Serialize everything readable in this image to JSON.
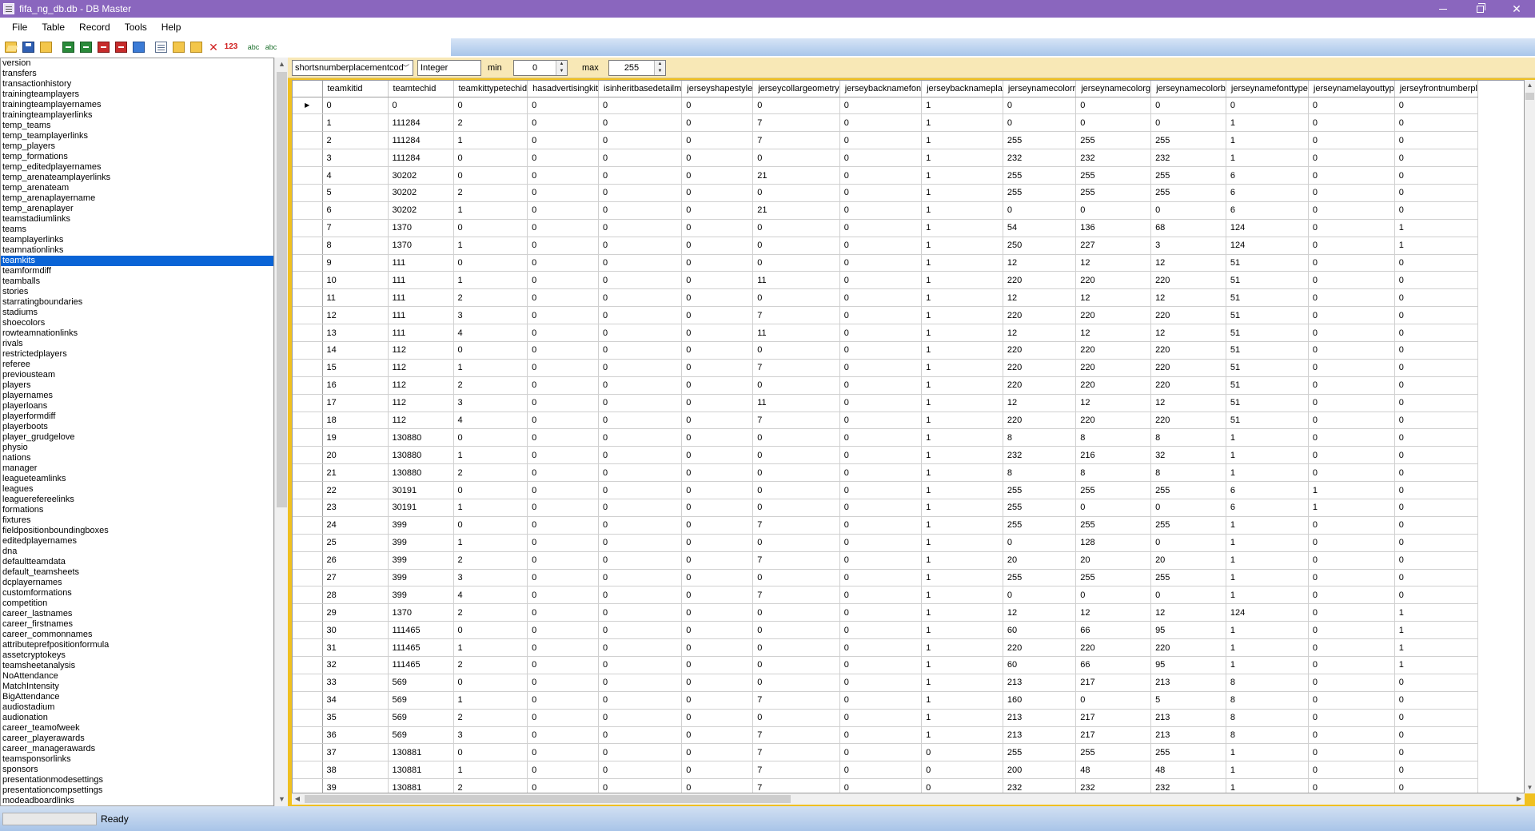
{
  "window": {
    "title": "fifa_ng_db.db - DB Master"
  },
  "menu": [
    "File",
    "Table",
    "Record",
    "Tools",
    "Help"
  ],
  "toolbar_icons": [
    "open-folder-icon",
    "save-icon",
    "folder-icon",
    "import-icon",
    "export-icon",
    "delete-table-icon",
    "delete-record-icon",
    "compare-icon",
    "copy-icon",
    "paste-icon",
    "paste-special-icon",
    "delete-icon",
    "numbers-icon",
    "spellcheck-icon",
    "find-replace-icon"
  ],
  "tables": [
    "version",
    "transfers",
    "transactionhistory",
    "trainingteamplayers",
    "trainingteamplayernames",
    "trainingteamplayerlinks",
    "temp_teams",
    "temp_teamplayerlinks",
    "temp_players",
    "temp_formations",
    "temp_editedplayernames",
    "temp_arenateamplayerlinks",
    "temp_arenateam",
    "temp_arenaplayername",
    "temp_arenaplayer",
    "teamstadiumlinks",
    "teams",
    "teamplayerlinks",
    "teamnationlinks",
    "teamkits",
    "teamformdiff",
    "teamballs",
    "stories",
    "starratingboundaries",
    "stadiums",
    "shoecolors",
    "rowteamnationlinks",
    "rivals",
    "restrictedplayers",
    "referee",
    "previousteam",
    "players",
    "playernames",
    "playerloans",
    "playerformdiff",
    "playerboots",
    "player_grudgelove",
    "physio",
    "nations",
    "manager",
    "leagueteamlinks",
    "leagues",
    "leaguerefereelinks",
    "formations",
    "fixtures",
    "fieldpositionboundingboxes",
    "editedplayernames",
    "dna",
    "defaultteamdata",
    "default_teamsheets",
    "dcplayernames",
    "customformations",
    "competition",
    "career_lastnames",
    "career_firstnames",
    "career_commonnames",
    "attributeprefpositionformula",
    "assetcryptokeys",
    "teamsheetanalysis",
    "NoAttendance",
    "MatchIntensity",
    "BigAttendance",
    "audiostadium",
    "audionation",
    "career_teamofweek",
    "career_playerawards",
    "career_managerawards",
    "teamsponsorlinks",
    "sponsors",
    "presentationmodesettings",
    "presentationcompsettings",
    "modeadboardlinks"
  ],
  "selected_table": "teamkits",
  "field_bar": {
    "field": "shortsnumberplacementcod",
    "type": "Integer",
    "min_label": "min",
    "min_value": "0",
    "max_label": "max",
    "max_value": "255"
  },
  "columns": [
    "teamkitid",
    "teamtechid",
    "teamkittypetechid",
    "hasadvertisingkit",
    "isinheritbasedetailm",
    "jerseyshapestyle",
    "jerseycollargeometry",
    "jerseybacknamefon",
    "jerseybacknamepla",
    "jerseynamecolorr",
    "jerseynamecolorg",
    "jerseynamecolorb",
    "jerseynamefonttype",
    "jerseynamelayouttyp",
    "jerseyfrontnumberpl"
  ],
  "rows": [
    [
      "0",
      "0",
      "0",
      "0",
      "0",
      "0",
      "0",
      "0",
      "1",
      "0",
      "0",
      "0",
      "0",
      "0",
      "0"
    ],
    [
      "1",
      "111284",
      "2",
      "0",
      "0",
      "0",
      "7",
      "0",
      "1",
      "0",
      "0",
      "0",
      "1",
      "0",
      "0"
    ],
    [
      "2",
      "111284",
      "1",
      "0",
      "0",
      "0",
      "7",
      "0",
      "1",
      "255",
      "255",
      "255",
      "1",
      "0",
      "0"
    ],
    [
      "3",
      "111284",
      "0",
      "0",
      "0",
      "0",
      "0",
      "0",
      "1",
      "232",
      "232",
      "232",
      "1",
      "0",
      "0"
    ],
    [
      "4",
      "30202",
      "0",
      "0",
      "0",
      "0",
      "21",
      "0",
      "1",
      "255",
      "255",
      "255",
      "6",
      "0",
      "0"
    ],
    [
      "5",
      "30202",
      "2",
      "0",
      "0",
      "0",
      "0",
      "0",
      "1",
      "255",
      "255",
      "255",
      "6",
      "0",
      "0"
    ],
    [
      "6",
      "30202",
      "1",
      "0",
      "0",
      "0",
      "21",
      "0",
      "1",
      "0",
      "0",
      "0",
      "6",
      "0",
      "0"
    ],
    [
      "7",
      "1370",
      "0",
      "0",
      "0",
      "0",
      "0",
      "0",
      "1",
      "54",
      "136",
      "68",
      "124",
      "0",
      "1"
    ],
    [
      "8",
      "1370",
      "1",
      "0",
      "0",
      "0",
      "0",
      "0",
      "1",
      "250",
      "227",
      "3",
      "124",
      "0",
      "1"
    ],
    [
      "9",
      "111",
      "0",
      "0",
      "0",
      "0",
      "0",
      "0",
      "1",
      "12",
      "12",
      "12",
      "51",
      "0",
      "0"
    ],
    [
      "10",
      "111",
      "1",
      "0",
      "0",
      "0",
      "11",
      "0",
      "1",
      "220",
      "220",
      "220",
      "51",
      "0",
      "0"
    ],
    [
      "11",
      "111",
      "2",
      "0",
      "0",
      "0",
      "0",
      "0",
      "1",
      "12",
      "12",
      "12",
      "51",
      "0",
      "0"
    ],
    [
      "12",
      "111",
      "3",
      "0",
      "0",
      "0",
      "7",
      "0",
      "1",
      "220",
      "220",
      "220",
      "51",
      "0",
      "0"
    ],
    [
      "13",
      "111",
      "4",
      "0",
      "0",
      "0",
      "11",
      "0",
      "1",
      "12",
      "12",
      "12",
      "51",
      "0",
      "0"
    ],
    [
      "14",
      "112",
      "0",
      "0",
      "0",
      "0",
      "0",
      "0",
      "1",
      "220",
      "220",
      "220",
      "51",
      "0",
      "0"
    ],
    [
      "15",
      "112",
      "1",
      "0",
      "0",
      "0",
      "7",
      "0",
      "1",
      "220",
      "220",
      "220",
      "51",
      "0",
      "0"
    ],
    [
      "16",
      "112",
      "2",
      "0",
      "0",
      "0",
      "0",
      "0",
      "1",
      "220",
      "220",
      "220",
      "51",
      "0",
      "0"
    ],
    [
      "17",
      "112",
      "3",
      "0",
      "0",
      "0",
      "11",
      "0",
      "1",
      "12",
      "12",
      "12",
      "51",
      "0",
      "0"
    ],
    [
      "18",
      "112",
      "4",
      "0",
      "0",
      "0",
      "7",
      "0",
      "1",
      "220",
      "220",
      "220",
      "51",
      "0",
      "0"
    ],
    [
      "19",
      "130880",
      "0",
      "0",
      "0",
      "0",
      "0",
      "0",
      "1",
      "8",
      "8",
      "8",
      "1",
      "0",
      "0"
    ],
    [
      "20",
      "130880",
      "1",
      "0",
      "0",
      "0",
      "0",
      "0",
      "1",
      "232",
      "216",
      "32",
      "1",
      "0",
      "0"
    ],
    [
      "21",
      "130880",
      "2",
      "0",
      "0",
      "0",
      "0",
      "0",
      "1",
      "8",
      "8",
      "8",
      "1",
      "0",
      "0"
    ],
    [
      "22",
      "30191",
      "0",
      "0",
      "0",
      "0",
      "0",
      "0",
      "1",
      "255",
      "255",
      "255",
      "6",
      "1",
      "0"
    ],
    [
      "23",
      "30191",
      "1",
      "0",
      "0",
      "0",
      "0",
      "0",
      "1",
      "255",
      "0",
      "0",
      "6",
      "1",
      "0"
    ],
    [
      "24",
      "399",
      "0",
      "0",
      "0",
      "0",
      "7",
      "0",
      "1",
      "255",
      "255",
      "255",
      "1",
      "0",
      "0"
    ],
    [
      "25",
      "399",
      "1",
      "0",
      "0",
      "0",
      "0",
      "0",
      "1",
      "0",
      "128",
      "0",
      "1",
      "0",
      "0"
    ],
    [
      "26",
      "399",
      "2",
      "0",
      "0",
      "0",
      "7",
      "0",
      "1",
      "20",
      "20",
      "20",
      "1",
      "0",
      "0"
    ],
    [
      "27",
      "399",
      "3",
      "0",
      "0",
      "0",
      "0",
      "0",
      "1",
      "255",
      "255",
      "255",
      "1",
      "0",
      "0"
    ],
    [
      "28",
      "399",
      "4",
      "0",
      "0",
      "0",
      "7",
      "0",
      "1",
      "0",
      "0",
      "0",
      "1",
      "0",
      "0"
    ],
    [
      "29",
      "1370",
      "2",
      "0",
      "0",
      "0",
      "0",
      "0",
      "1",
      "12",
      "12",
      "12",
      "124",
      "0",
      "1"
    ],
    [
      "30",
      "111465",
      "0",
      "0",
      "0",
      "0",
      "0",
      "0",
      "1",
      "60",
      "66",
      "95",
      "1",
      "0",
      "1"
    ],
    [
      "31",
      "111465",
      "1",
      "0",
      "0",
      "0",
      "0",
      "0",
      "1",
      "220",
      "220",
      "220",
      "1",
      "0",
      "1"
    ],
    [
      "32",
      "111465",
      "2",
      "0",
      "0",
      "0",
      "0",
      "0",
      "1",
      "60",
      "66",
      "95",
      "1",
      "0",
      "1"
    ],
    [
      "33",
      "569",
      "0",
      "0",
      "0",
      "0",
      "0",
      "0",
      "1",
      "213",
      "217",
      "213",
      "8",
      "0",
      "0"
    ],
    [
      "34",
      "569",
      "1",
      "0",
      "0",
      "0",
      "7",
      "0",
      "1",
      "160",
      "0",
      "5",
      "8",
      "0",
      "0"
    ],
    [
      "35",
      "569",
      "2",
      "0",
      "0",
      "0",
      "0",
      "0",
      "1",
      "213",
      "217",
      "213",
      "8",
      "0",
      "0"
    ],
    [
      "36",
      "569",
      "3",
      "0",
      "0",
      "0",
      "7",
      "0",
      "1",
      "213",
      "217",
      "213",
      "8",
      "0",
      "0"
    ],
    [
      "37",
      "130881",
      "0",
      "0",
      "0",
      "0",
      "7",
      "0",
      "0",
      "255",
      "255",
      "255",
      "1",
      "0",
      "0"
    ],
    [
      "38",
      "130881",
      "1",
      "0",
      "0",
      "0",
      "7",
      "0",
      "0",
      "200",
      "48",
      "48",
      "1",
      "0",
      "0"
    ],
    [
      "39",
      "130881",
      "2",
      "0",
      "0",
      "0",
      "7",
      "0",
      "0",
      "232",
      "232",
      "232",
      "1",
      "0",
      "0"
    ]
  ],
  "status": {
    "text": "Ready"
  },
  "colors": {
    "titlebar": "#8a66be",
    "selection": "#0a64d6",
    "frame": "#f0c020"
  }
}
